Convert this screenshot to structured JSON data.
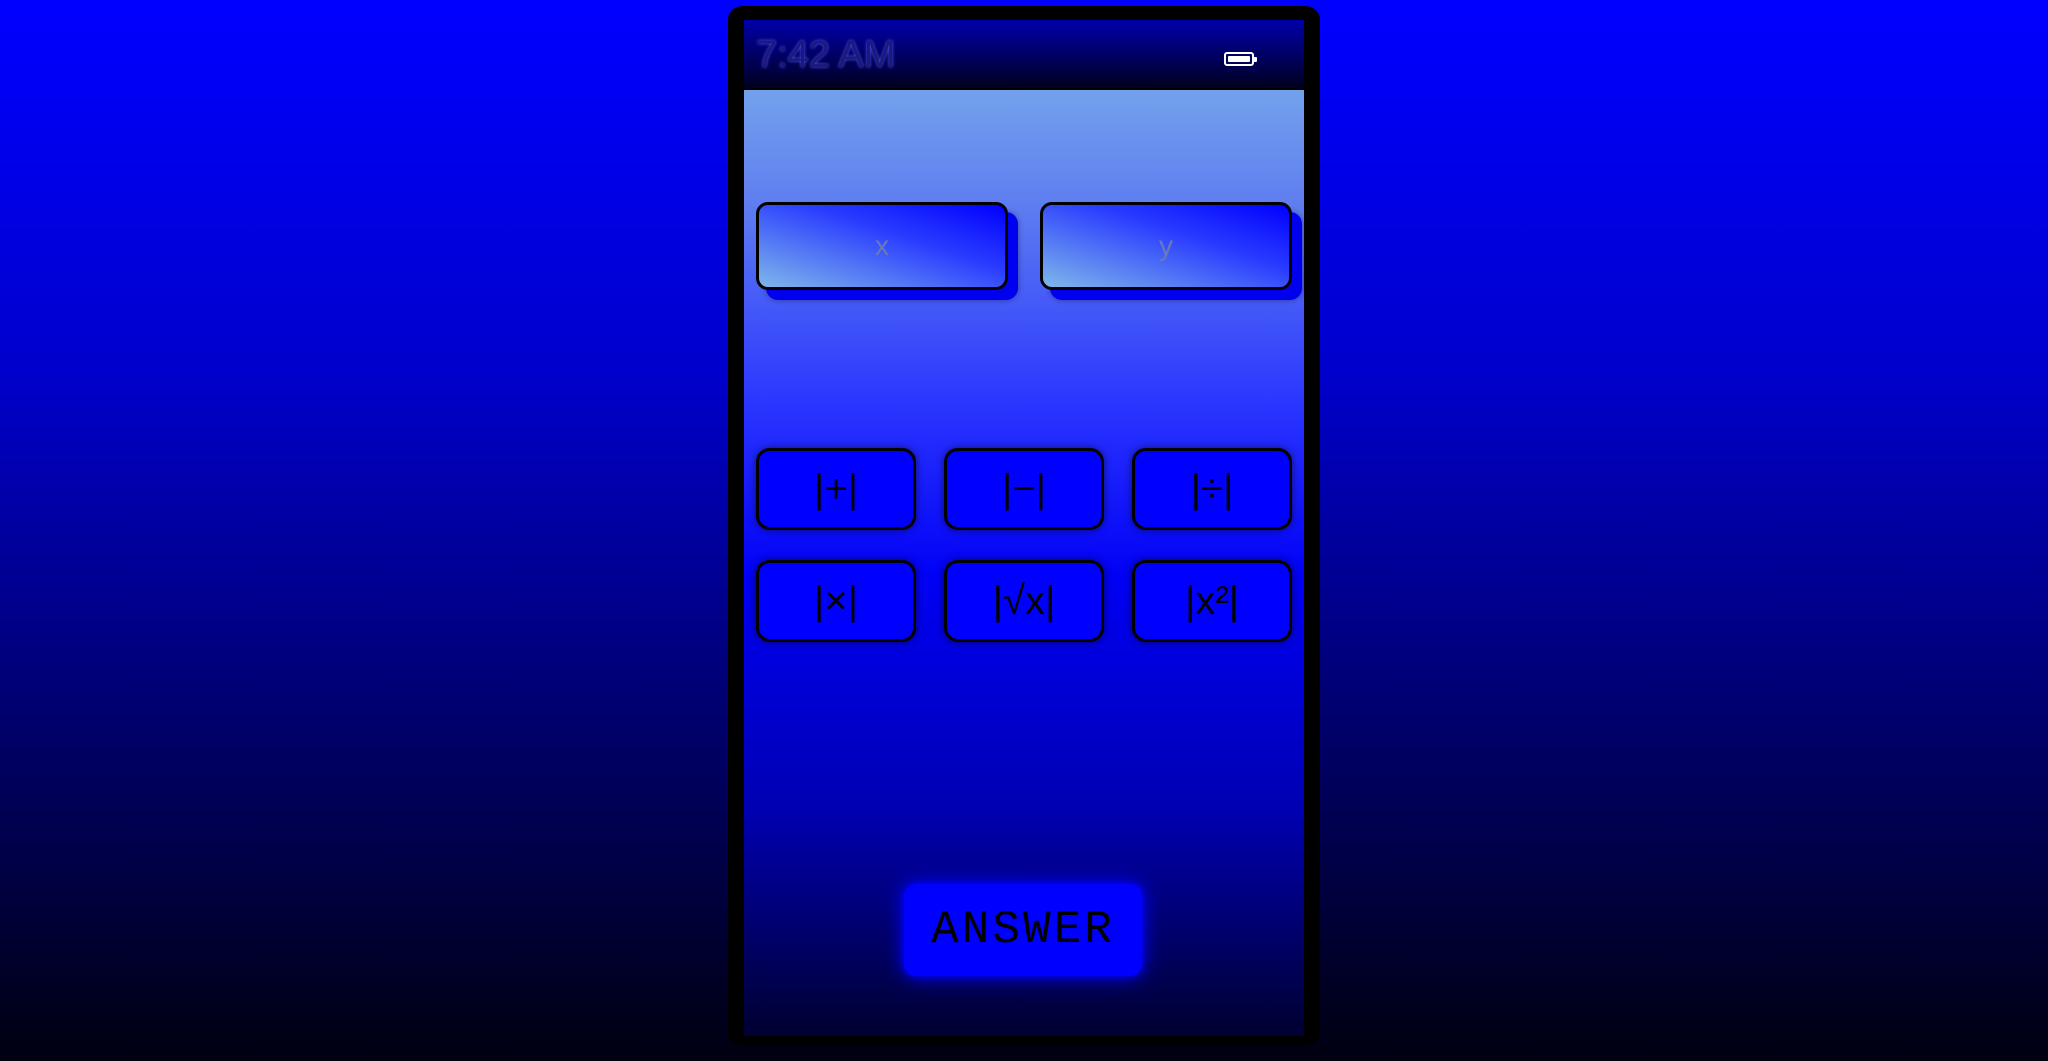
{
  "status_bar": {
    "time": "7:42 AM",
    "battery_icon": "battery-full-icon"
  },
  "inputs": {
    "x_placeholder": "x",
    "y_placeholder": "y"
  },
  "operations": {
    "add": "|+|",
    "subtract": "|−|",
    "divide": "|÷|",
    "multiply": "|×|",
    "sqrt": "|√x|",
    "square": "|x²|"
  },
  "answer_button": {
    "label": "ANSWER"
  },
  "colors": {
    "accent": "#0000ff",
    "border": "#000000",
    "placeholder": "#6a7ab6"
  }
}
